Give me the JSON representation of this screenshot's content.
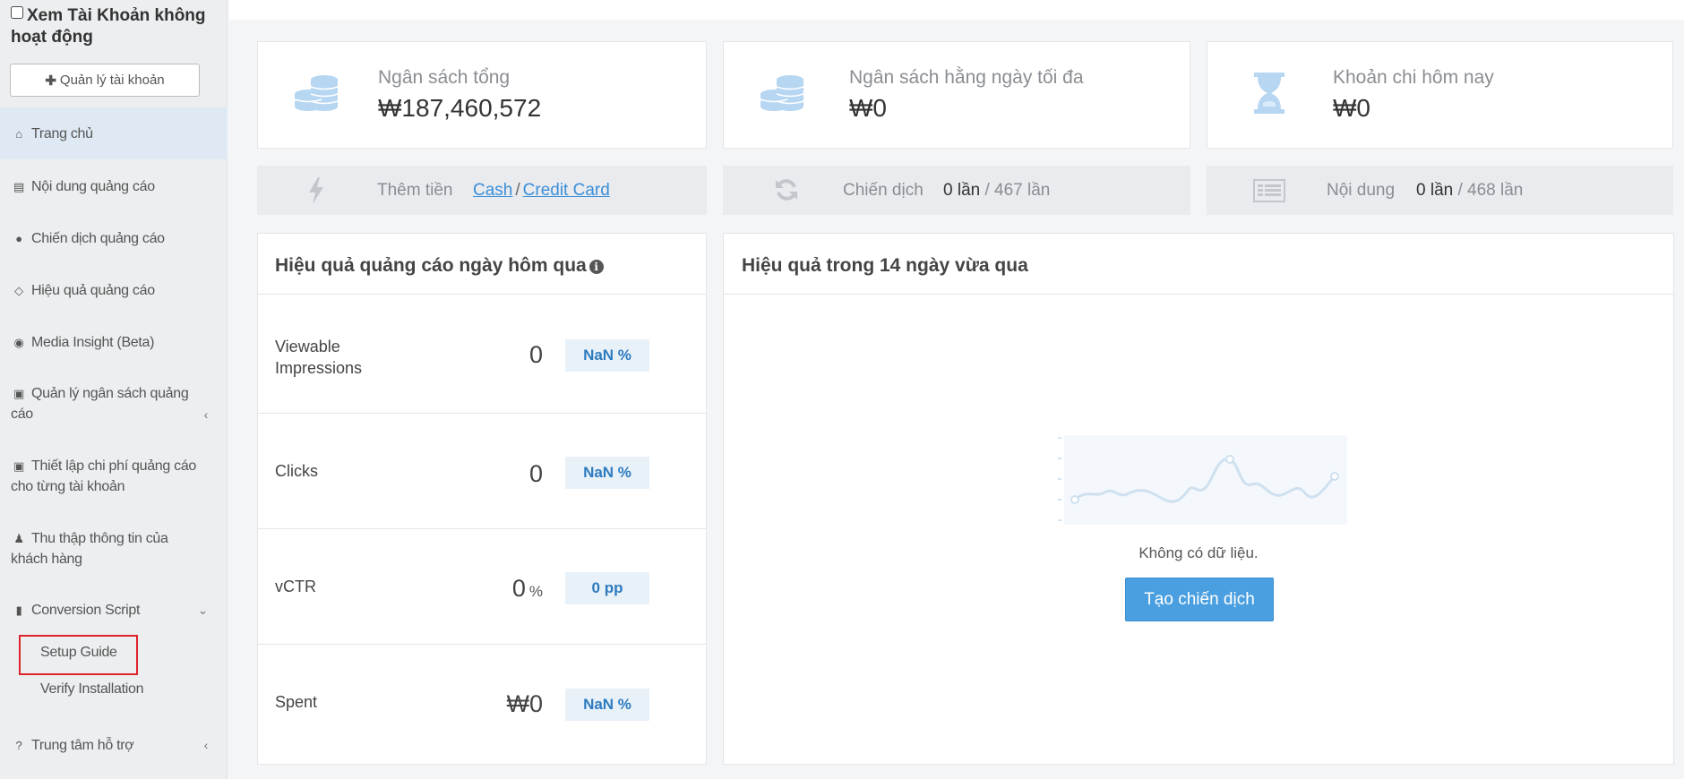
{
  "sidebar": {
    "inactive_accounts_label": "Xem Tài Khoản không hoạt động",
    "manage_accounts_label": "Quản lý tài khoản",
    "items": [
      {
        "label": "Trang chủ",
        "icon": "home-icon"
      },
      {
        "label": "Nội dung quảng cáo",
        "icon": "ad-content-icon"
      },
      {
        "label": "Chiến dịch quảng cáo",
        "icon": "globe-icon"
      },
      {
        "label": "Hiệu quả quảng cáo",
        "icon": "diamond-icon"
      },
      {
        "label": "Media Insight (Beta)",
        "icon": "eye-icon"
      },
      {
        "label": "Quản lý ngân sách quảng cáo",
        "icon": "money-icon"
      },
      {
        "label": "Thiết lập chi phí quảng cáo cho từng tài khoản",
        "icon": "money-icon"
      },
      {
        "label": "Thu thập thông tin của khách hàng",
        "icon": "users-icon"
      },
      {
        "label": "Conversion Script",
        "icon": "book-icon"
      },
      {
        "label": "Trung tâm hỗ trợ",
        "icon": "question-icon"
      }
    ],
    "sub_items": [
      "Setup Guide",
      "Verify Installation"
    ]
  },
  "stats": [
    {
      "label": "Ngân sách tổng",
      "value": "₩187,460,572",
      "icon": "coins-icon"
    },
    {
      "label": "Ngân sách hằng ngày tối đa",
      "value": "₩0",
      "icon": "coins-icon"
    },
    {
      "label": "Khoản chi hôm nay",
      "value": "₩0",
      "icon": "hourglass-icon"
    }
  ],
  "strips": {
    "add_money": {
      "label": "Thêm tiền",
      "cash": "Cash",
      "separator": "/",
      "credit_card": "Credit Card"
    },
    "campaign": {
      "label": "Chiến dịch",
      "count": "0 lần",
      "total": "/ 467 lần"
    },
    "content": {
      "label": "Nội dung",
      "count": "0 lần",
      "total": "/ 468 lần"
    }
  },
  "yesterday": {
    "title": "Hiệu quả quảng cáo ngày hôm qua",
    "metrics": [
      {
        "label": "Viewable Impressions",
        "value": "0",
        "unit": "",
        "badge": "NaN %"
      },
      {
        "label": "Clicks",
        "value": "0",
        "unit": "",
        "badge": "NaN %"
      },
      {
        "label": "vCTR",
        "value": "0",
        "unit": "%",
        "badge": "0 pp"
      },
      {
        "label": "Spent",
        "value": "₩0",
        "unit": "",
        "badge": "NaN %"
      }
    ]
  },
  "trend": {
    "title": "Hiệu quả trong 14 ngày vừa qua",
    "empty_text": "Không có dữ liệu.",
    "create_button": "Tạo chiến dịch"
  },
  "colors": {
    "accent": "#4a9fe0",
    "icon_light_blue": "#b6d6f2",
    "badge_bg": "#e9f1f8",
    "badge_text": "#2d7bbf",
    "highlight_box": "#e0242b",
    "active_nav": "#dfe9f3"
  }
}
